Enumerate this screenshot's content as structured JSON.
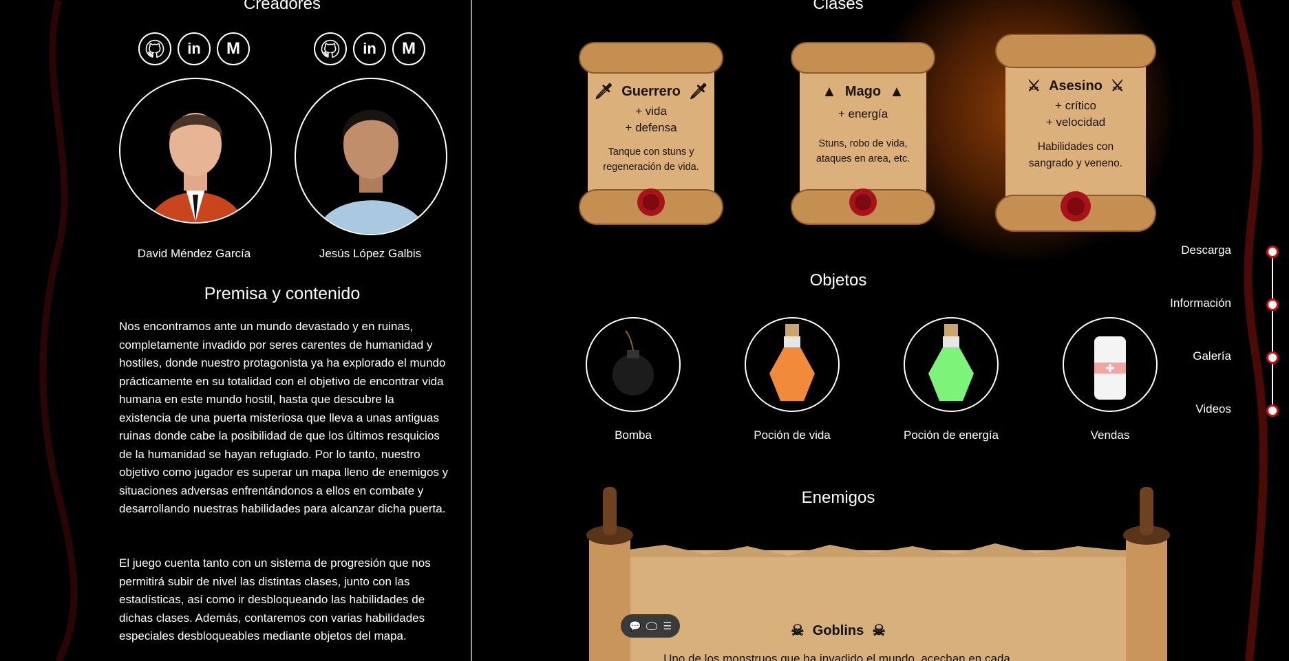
{
  "creators": {
    "title": "Creadores",
    "people": [
      {
        "name": "David Méndez García",
        "socials": [
          "github-icon",
          "linkedin-icon",
          "gmail-icon"
        ]
      },
      {
        "name": "Jesús López Galbis",
        "socials": [
          "github-icon",
          "linkedin-icon",
          "gmail-icon"
        ]
      }
    ]
  },
  "premise": {
    "title": "Premisa y contenido",
    "paragraph1": "Nos encontramos ante un mundo devastado y en ruinas, completamente invadido por seres carentes de humanidad y hostiles, donde nuestro protagonista ya ha explorado el mundo prácticamente en su totalidad con el objetivo de encontrar vida humana en este mundo hostil, hasta que descubre la existencia de una puerta misteriosa que lleva a unas antiguas ruinas donde cabe la posibilidad de que los últimos resquicios de la humanidad se hayan refugiado. Por lo tanto, nuestro objetivo como jugador es superar un mapa lleno de enemigos y situaciones adversas enfrentándonos a ellos en combate y desarrollando nuestras habilidades para alcanzar dicha puerta.",
    "paragraph2": "El juego cuenta tanto con un sistema de progresión que nos permitirá subir de nivel las distintas clases, junto con las estadísticas, así como ir desbloqueando las habilidades de dichas clases. Además, contaremos con varias habilidades especiales desbloqueables mediante objetos del mapa."
  },
  "classes": {
    "title": "Clases",
    "items": [
      {
        "name": "Guerrero",
        "icon": "sword-icon",
        "stat1": "+ vida",
        "stat2": "+ defensa",
        "desc": "Tanque con stuns y regeneración de vida."
      },
      {
        "name": "Mago",
        "icon": "wizard-hat-icon",
        "stat1": "+ energía",
        "desc": "Stuns, robo de vida, ataques en area, etc."
      },
      {
        "name": "Asesino",
        "icon": "daggers-icon",
        "stat1": "+ crítico",
        "stat2": "+ velocidad",
        "desc": "Habilidades con sangrado y veneno."
      }
    ]
  },
  "objects": {
    "title": "Objetos",
    "items": [
      {
        "name": "Bomba",
        "icon": "bomb-icon"
      },
      {
        "name": "Poción de vida",
        "icon": "health-potion-icon"
      },
      {
        "name": "Poción de energía",
        "icon": "energy-potion-icon"
      },
      {
        "name": "Vendas",
        "icon": "bandage-icon"
      }
    ]
  },
  "enemies": {
    "title": "Enemigos",
    "first": {
      "name": "Goblins",
      "icon": "goblin-icon",
      "desc_partial": "Uno de los monstruos que ha invadido el mundo, acechan en cada"
    }
  },
  "side_nav": {
    "items": [
      "Descarga",
      "Información",
      "Galería",
      "Videos"
    ]
  },
  "toolbar": {
    "icons": [
      "comment-icon",
      "toggle-icon",
      "settings-icon"
    ]
  },
  "colors": {
    "background": "#000000",
    "accent": "#d10a0a",
    "parchment": "#e2bf8b"
  }
}
